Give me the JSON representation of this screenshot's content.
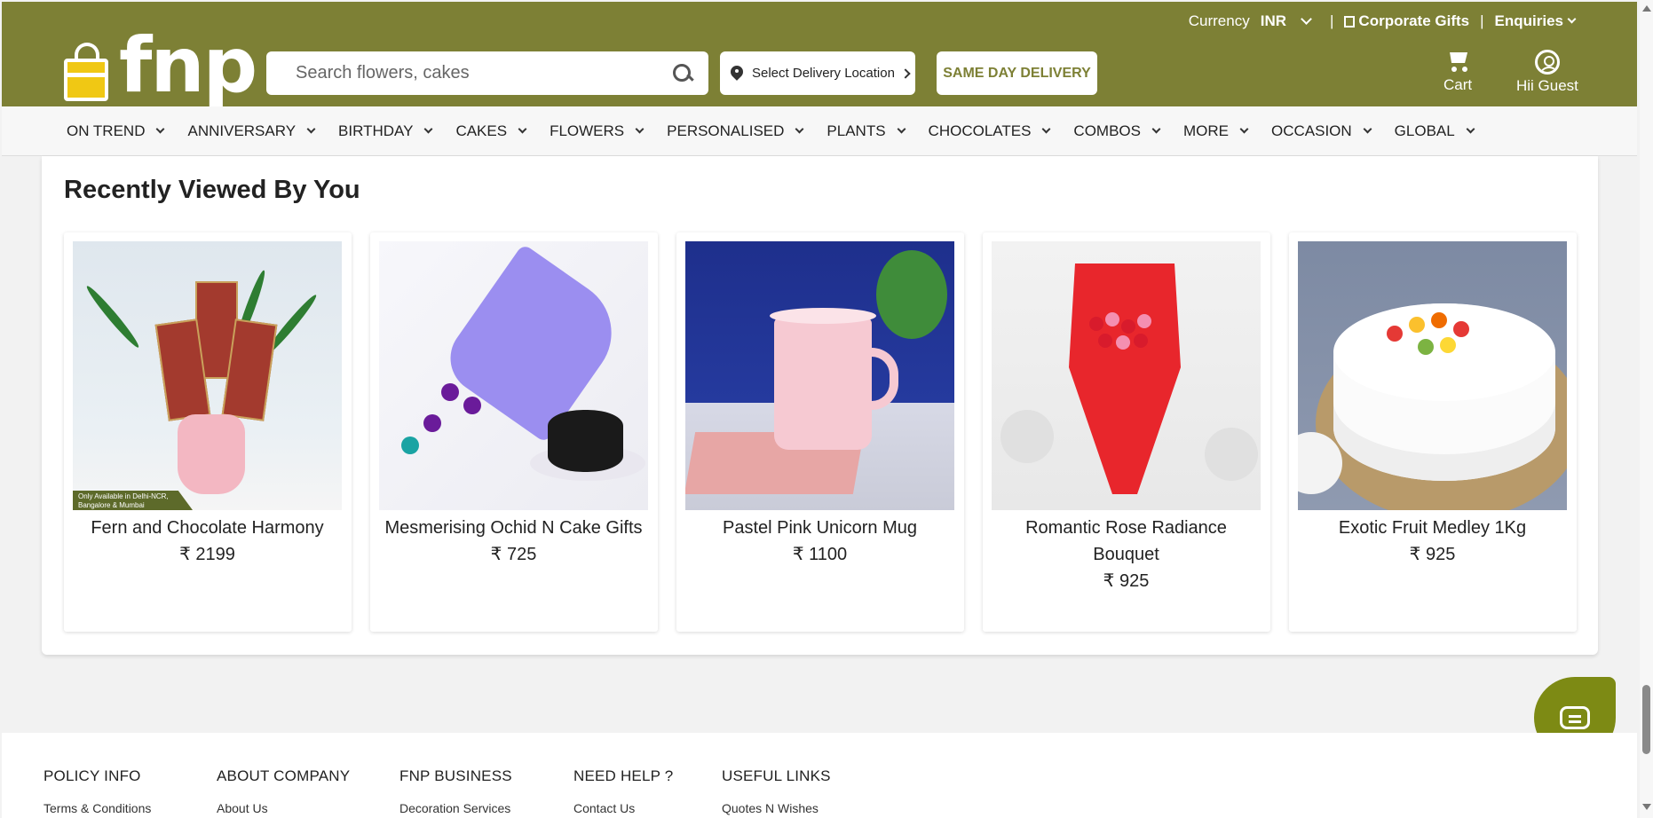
{
  "topbar": {
    "currency_label": "Currency",
    "currency_value": "INR",
    "separator": "|",
    "corporate_gifts": "Corporate Gifts",
    "enquiries": "Enquiries"
  },
  "brand": {
    "logo_text": "fnp"
  },
  "search": {
    "placeholder": "Search flowers, cakes"
  },
  "location": {
    "label": "Select Delivery Location"
  },
  "same_day": {
    "label": "SAME DAY DELIVERY"
  },
  "header_actions": {
    "cart_label": "Cart",
    "user_label": "Hii Guest"
  },
  "nav": {
    "items": [
      {
        "label": "ON TREND"
      },
      {
        "label": "ANNIVERSARY"
      },
      {
        "label": "BIRTHDAY"
      },
      {
        "label": "CAKES"
      },
      {
        "label": "FLOWERS"
      },
      {
        "label": "PERSONALISED"
      },
      {
        "label": "PLANTS"
      },
      {
        "label": "CHOCOLATES"
      },
      {
        "label": "COMBOS"
      },
      {
        "label": "MORE"
      },
      {
        "label": "OCCASION"
      },
      {
        "label": "GLOBAL"
      }
    ]
  },
  "recently_viewed": {
    "title": "Recently Viewed By You",
    "products": [
      {
        "name": "Fern and Chocolate Harmony",
        "price": "₹ 2199",
        "badge": "Only Available in Delhi-NCR, Bangalore & Mumbai"
      },
      {
        "name": "Mesmerising Ochid N Cake Gifts",
        "price": "₹ 725"
      },
      {
        "name": "Pastel Pink Unicorn Mug",
        "price": "₹ 1100"
      },
      {
        "name": "Romantic Rose Radiance Bouquet",
        "price": "₹ 925"
      },
      {
        "name": "Exotic Fruit Medley 1Kg",
        "price": "₹ 925"
      }
    ]
  },
  "footer": {
    "columns": [
      {
        "heading": "POLICY INFO",
        "first_link": "Terms & Conditions"
      },
      {
        "heading": "ABOUT COMPANY",
        "first_link": "About Us"
      },
      {
        "heading": "FNP BUSINESS",
        "first_link": "Decoration Services"
      },
      {
        "heading": "NEED HELP ?",
        "first_link": "Contact Us"
      },
      {
        "heading": "USEFUL LINKS",
        "first_link": "Quotes N Wishes"
      }
    ]
  },
  "colors": {
    "brand_olive": "#7d8035",
    "chat_button": "#7d8a14",
    "logo_yellow": "#f0c814"
  },
  "icons": [
    "search-icon",
    "location-pin-icon",
    "chevron-right-icon",
    "cart-icon",
    "user-icon",
    "chevron-down-icon",
    "building-icon",
    "chat-icon"
  ]
}
